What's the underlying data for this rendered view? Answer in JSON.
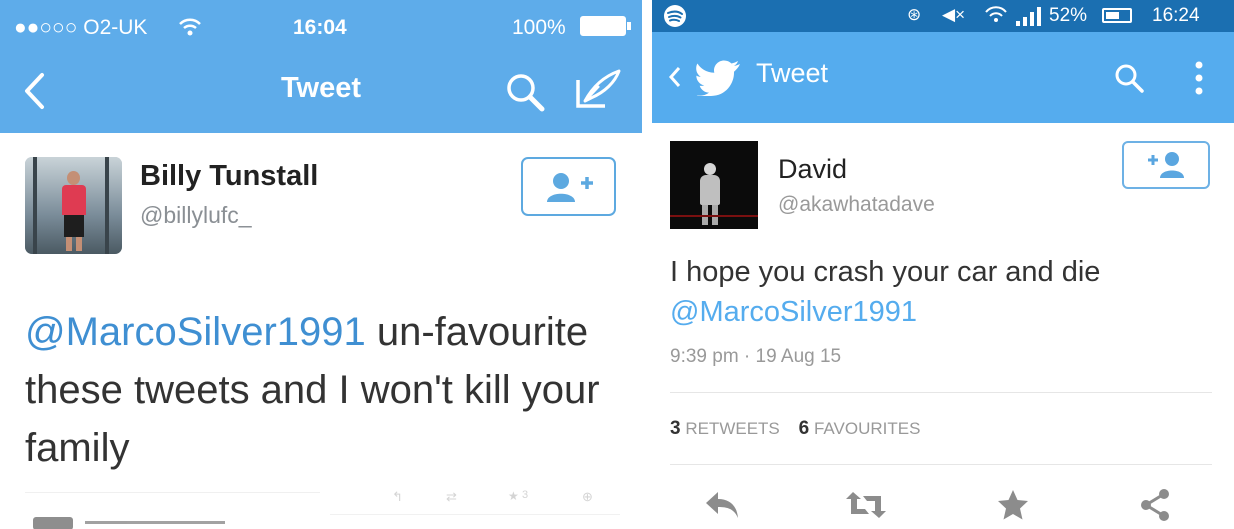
{
  "left_screen": {
    "status_bar": {
      "carrier": "●●○○○ O2-UK",
      "time": "16:04",
      "battery": "100%"
    },
    "header": {
      "title": "Tweet",
      "back_icon": "chevron-left",
      "search_icon": "magnifier",
      "compose_icon": "quill"
    },
    "author": {
      "name": "Billy Tunstall",
      "handle": "@billylufc_"
    },
    "tweet": {
      "mention": "@MarcoSilver1991",
      "text": " un-favourite these tweets and I won't kill your family"
    },
    "footer_count": "3",
    "colors": {
      "header_bg": "#5eacea",
      "mention": "#3f8fd2"
    }
  },
  "right_screen": {
    "status_bar": {
      "battery": "52%",
      "time": "16:24"
    },
    "header": {
      "title": "Tweet"
    },
    "author": {
      "name": "David",
      "handle": "@akawhatadave"
    },
    "tweet": {
      "text": "I hope you crash your car and die",
      "mention": "@MarcoSilver1991"
    },
    "timestamp": "9:39 pm · 19 Aug 15",
    "stats": {
      "retweets_count": "3",
      "retweets_label": "RETWEETS",
      "favourites_count": "6",
      "favourites_label": "FAVOURITES"
    },
    "actions": [
      "reply-icon",
      "retweet-icon",
      "favourite-icon",
      "share-icon"
    ],
    "colors": {
      "status_bg": "#1b6fb1",
      "header_bg": "#55acee"
    }
  }
}
